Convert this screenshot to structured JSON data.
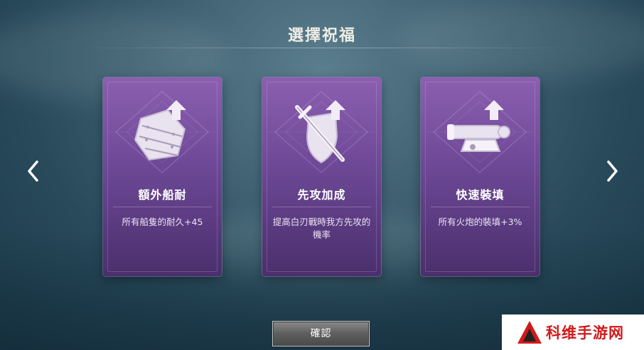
{
  "screen": {
    "title": "選擇祝福",
    "confirm_label": "確認"
  },
  "navigation": {
    "left_icon": "chevron-left-icon",
    "right_icon": "chevron-right-icon"
  },
  "blessings": [
    {
      "name": "額外船耐",
      "description": "所有船隻的耐久+45",
      "icon": "ship-plank-upgrade-icon"
    },
    {
      "name": "先攻加成",
      "description": "提高白刃戰時我方先攻的機率",
      "icon": "sword-shield-upgrade-icon"
    },
    {
      "name": "快速裝填",
      "description": "所有火炮的裝填+3%",
      "icon": "cannon-upgrade-icon"
    }
  ],
  "watermark": {
    "text": "科维手游网"
  },
  "colors": {
    "card_top": "#8c5fb0",
    "card_bottom": "#4a2f6c",
    "button": "#5e5e5e",
    "watermark_red": "#d01a1a"
  }
}
